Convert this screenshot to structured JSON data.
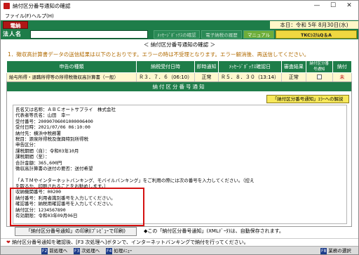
{
  "window": {
    "title": "納付区分番号通知の確認",
    "minimize": "—",
    "maximize": "☐",
    "close": "✕"
  },
  "menu": {
    "file": "ファイル(F)",
    "help": "ヘルプ(H)"
  },
  "header": {
    "status_badge": "電納",
    "date": "本日：令和 5年 8月30日(水)",
    "corp_label": "法人名",
    "tabs": [
      "ﾒｯｾｰｼﾞﾎﾞｯｸｽの確認",
      "電子納税の履歴",
      "マニュアル",
      "TKCｼｽﾃﾑQ＆A"
    ]
  },
  "section_title": "＜ 納付区分番号通知の確認 ＞",
  "notice": "1．徴収高計算書データの送信結果は以下のとおりです。エラーの時は不受理となります。エラー解消後、再送信してください。",
  "summary_table": {
    "headers": [
      "申告の種類",
      "納税受付日時",
      "即時通知",
      "ﾒｯｾｰｼﾞﾎﾞｯｸｽ確認日",
      "審査結果",
      "納付区分番号通知",
      "納付"
    ],
    "rows": [
      [
        "給与所得・退職所得等の所得税徴収高計算書（一般）",
        "Ｒ３．７．６（06:10）",
        "正常",
        "Ｒ５．８．３０（13:14）",
        "正常",
        "",
        "未"
      ]
    ]
  },
  "panel": {
    "title": "納付区分番号通知",
    "help_button": "「納付区分番号通知」ｴﾗｰへの解説"
  },
  "notice_lines": [
    "氏名又は名称：ＡＢＣオートサプライ　株式会社",
    "代表者等氏名：山田　幸一",
    "受付番号：20090706001000006400",
    "受付日時：2021/07/06 06:10:00",
    "納付先：横浜中税務署",
    "税目：源泉所得税及復興特別所得税",
    "申告区分：",
    "課税期間（自）：令和03年10月",
    "課税期間（至）：",
    "合計金額：365,600円",
    "徴収高計算書の送付の要否：送付希望",
    "",
    "「ＡＴＭやインターネットバンキング、モバイルバンキング」をご利用の際には次の番号を入力してください。（控え",
    "を取るか、印刷されることをお勧めします。）",
    "収納機関番号：00200",
    "納付番号：利用者識別番号を入力してください。",
    "確認番号：納税用確認番号を入力してください。",
    "納付区分：1234567890",
    "有効期限：令和03年09月06日"
  ],
  "print_button": "「納付区分番号通知」の印刷(ﾌﾟﾚﾋﾞｭｰで印刷)",
  "autosave_note": "◆この「納付区分番号通知」(XMLﾃﾞｰﾀ)は、自動保存されます。",
  "status_message": "納付区分番号通知を確認後、[F3 次処理へ]ボタンで、インターネットバンキングで納付を行ってください。",
  "function_keys": [
    {
      "key": "F2",
      "label": "前処理へ"
    },
    {
      "key": "F3",
      "label": "次処理へ"
    },
    {
      "key": "F4",
      "label": "処理ﾒﾆｭｰ"
    },
    {
      "key": "F8",
      "label": "業務の選択"
    }
  ],
  "colors": {
    "header_green": "#1e7d49",
    "alert_red": "#c41818",
    "highlight_border": "#d41111",
    "help_yellow": "#f7e85a"
  }
}
